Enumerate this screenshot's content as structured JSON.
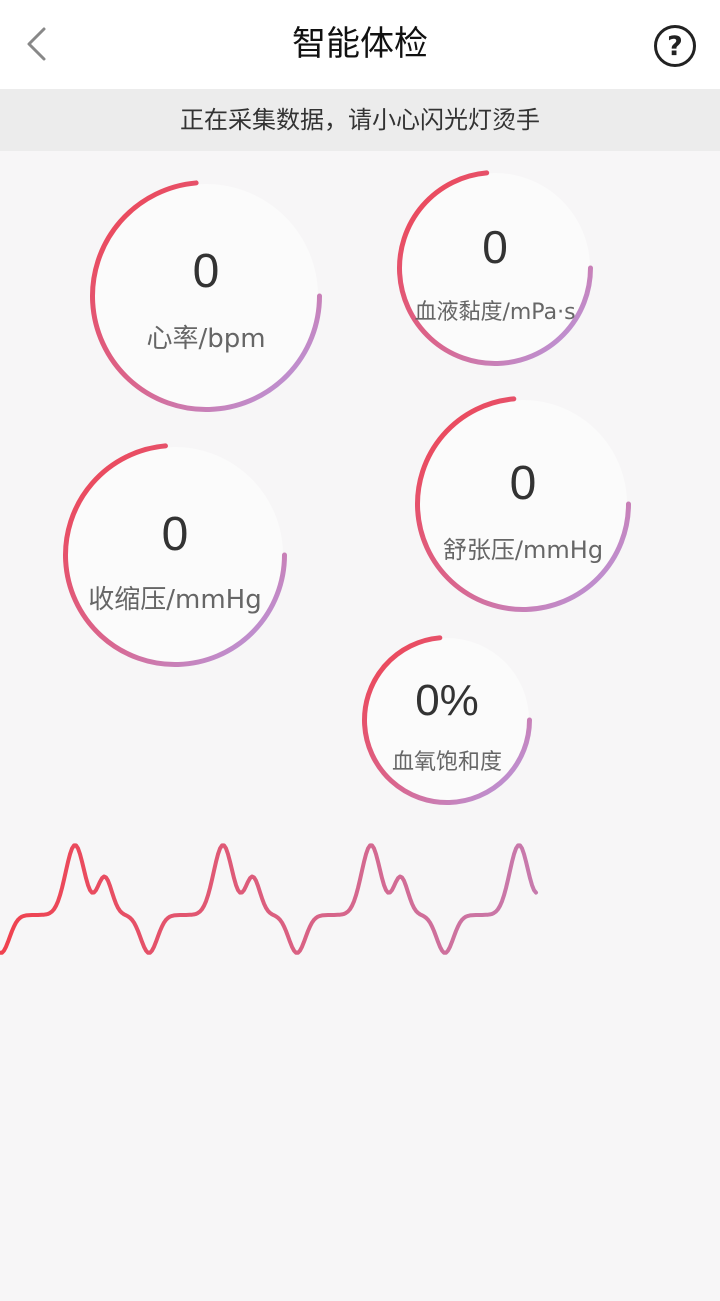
{
  "header": {
    "title": "智能体检",
    "back_icon": "chevron-left-icon",
    "help_icon": "?"
  },
  "notice": {
    "text": "正在采集数据，请小心闪光灯烫手"
  },
  "gauges": {
    "heart_rate": {
      "value": "0",
      "label": "心率/bpm"
    },
    "blood_viscosity": {
      "value": "0",
      "label": "血液黏度/mPa·s"
    },
    "systolic": {
      "value": "0",
      "label": "收缩压/mmHg"
    },
    "diastolic": {
      "value": "0",
      "label": "舒张压/mmHg"
    },
    "spo2": {
      "value": "0%",
      "label": "血氧饱和度"
    }
  },
  "colors": {
    "gradient_start": "#f0424f",
    "gradient_mid": "#d9668f",
    "gradient_end": "#b3a0ea",
    "background": "#f7f6f7"
  }
}
